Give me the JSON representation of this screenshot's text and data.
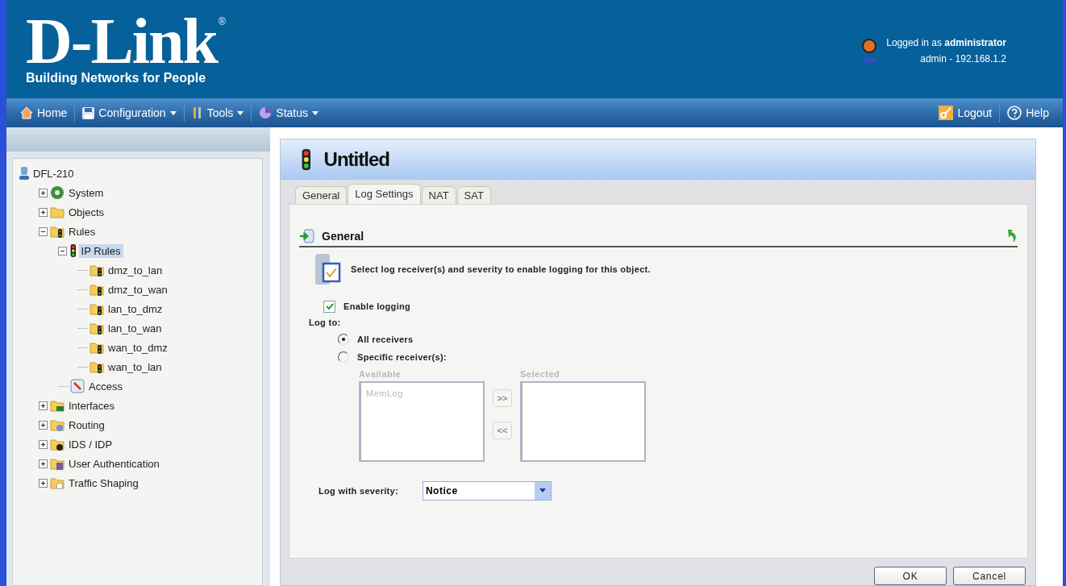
{
  "header": {
    "logo": "D-Link",
    "logo_mark": "®",
    "tagline": "Building Networks for People",
    "login_line": "Logged in as **administrator**",
    "session": "admin - 192.168.1.2"
  },
  "nav": {
    "left": [
      {
        "label": "Home",
        "kind": "home",
        "dropdown": false
      },
      {
        "label": "Configuration",
        "kind": "config",
        "dropdown": true
      },
      {
        "label": "Tools",
        "kind": "tools",
        "dropdown": true
      },
      {
        "label": "Status",
        "kind": "status",
        "dropdown": true
      }
    ],
    "right": [
      {
        "label": "Logout",
        "kind": "logout"
      },
      {
        "label": "Help",
        "kind": "help"
      }
    ]
  },
  "tree": {
    "label": "DFL-210",
    "kind": "device",
    "selected": false,
    "children": [
      {
        "label": "System",
        "kind": "system",
        "expanded": false,
        "selected": false
      },
      {
        "label": "Objects",
        "kind": "folder",
        "expanded": false,
        "selected": false
      },
      {
        "label": "Rules",
        "kind": "rules",
        "expanded": true,
        "selected": false,
        "children": [
          {
            "label": "IP Rules",
            "kind": "light",
            "expanded": true,
            "selected": true,
            "children": [
              {
                "label": "dmz_to_lan",
                "kind": "rule",
                "selected": false
              },
              {
                "label": "dmz_to_wan",
                "kind": "rule",
                "selected": false
              },
              {
                "label": "lan_to_dmz",
                "kind": "rule",
                "selected": false
              },
              {
                "label": "lan_to_wan",
                "kind": "rule",
                "selected": false
              },
              {
                "label": "wan_to_dmz",
                "kind": "rule",
                "selected": false
              },
              {
                "label": "wan_to_lan",
                "kind": "rule",
                "selected": false
              }
            ]
          },
          {
            "label": "Access",
            "kind": "access",
            "selected": false
          }
        ]
      },
      {
        "label": "Interfaces",
        "kind": "interfaces",
        "expanded": false,
        "selected": false
      },
      {
        "label": "Routing",
        "kind": "routing",
        "expanded": false,
        "selected": false
      },
      {
        "label": "IDS / IDP",
        "kind": "ids",
        "expanded": false,
        "selected": false
      },
      {
        "label": "User Authentication",
        "kind": "users",
        "expanded": false,
        "selected": false
      },
      {
        "label": "Traffic Shaping",
        "kind": "shaping",
        "expanded": false,
        "selected": false
      }
    ]
  },
  "dialog": {
    "title": "Untitled",
    "tabs": [
      {
        "label": "General",
        "selected": false
      },
      {
        "label": "Log Settings",
        "selected": true
      },
      {
        "label": "NAT",
        "selected": false
      },
      {
        "label": "SAT",
        "selected": false
      }
    ],
    "section": "General",
    "description": "Select log receiver(s) and severity to enable logging for this object.",
    "enable_logging": {
      "label": "Enable logging",
      "checked": true
    },
    "log_to": "Log to:",
    "options": [
      {
        "label": "All receivers",
        "selected": true
      },
      {
        "label": "Specific receiver(s):",
        "selected": false
      }
    ],
    "receivers": {
      "disabled": true,
      "available_label": "Available",
      "available": [
        "MemLog"
      ],
      "selected_label": "Selected",
      "add": ">>",
      "remove": "<<"
    },
    "severity": {
      "label": "Log with severity:",
      "value": "Notice"
    },
    "buttons": [
      "OK",
      "Cancel"
    ]
  }
}
